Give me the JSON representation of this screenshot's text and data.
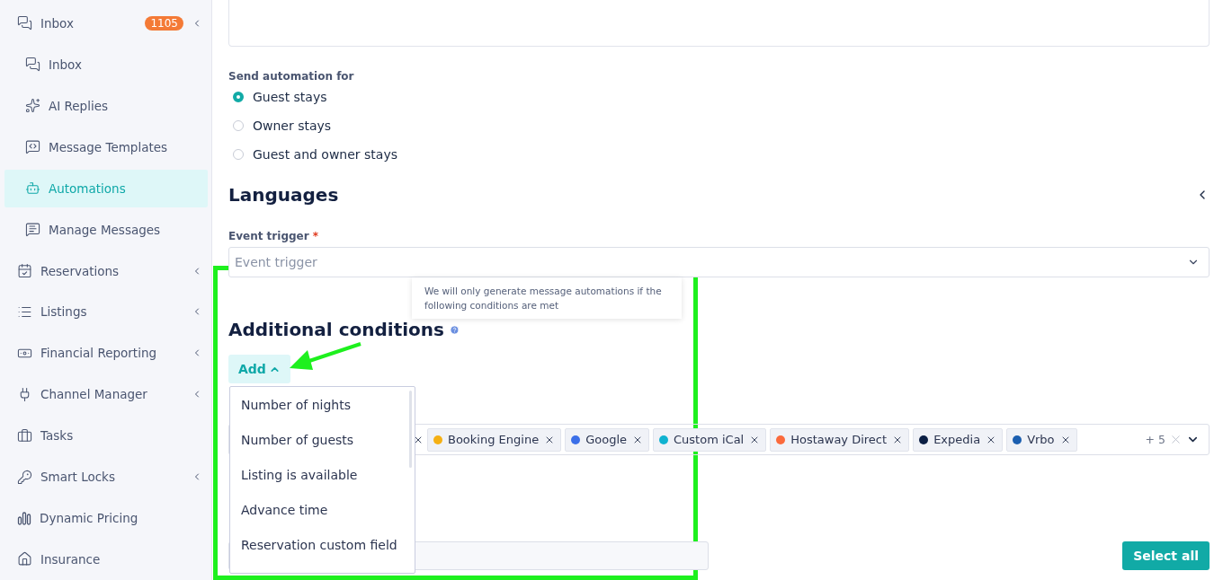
{
  "sidebar": {
    "items": [
      {
        "label": "Inbox",
        "badge": "1105",
        "expandable": true,
        "selected": false,
        "children": [
          {
            "label": "Inbox",
            "selected": false
          },
          {
            "label": "AI Replies",
            "selected": false
          },
          {
            "label": "Message Templates",
            "selected": false
          },
          {
            "label": "Automations",
            "selected": true
          },
          {
            "label": "Manage Messages",
            "selected": false
          }
        ]
      },
      {
        "label": "Reservations",
        "expandable": true,
        "selected": false
      },
      {
        "label": "Listings",
        "expandable": true,
        "selected": false
      },
      {
        "label": "Financial Reporting",
        "expandable": true,
        "selected": false
      },
      {
        "label": "Channel Manager",
        "expandable": true,
        "selected": false
      },
      {
        "label": "Tasks",
        "expandable": false,
        "selected": false
      },
      {
        "label": "Smart Locks",
        "expandable": true,
        "selected": false
      },
      {
        "label": "Dynamic Pricing",
        "expandable": false,
        "selected": false
      },
      {
        "label": "Insurance",
        "expandable": false,
        "selected": false
      }
    ]
  },
  "send_for": {
    "label": "Send automation for",
    "options": [
      {
        "label": "Guest stays",
        "selected": true
      },
      {
        "label": "Owner stays",
        "selected": false
      },
      {
        "label": "Guest and owner stays",
        "selected": false
      }
    ]
  },
  "languages": {
    "title": "Languages",
    "expanded": false
  },
  "event_trigger": {
    "label": "Event trigger",
    "required_mark": "*",
    "placeholder": "Event trigger"
  },
  "tooltip": "We will only generate message automations if the following conditions are met",
  "additional_conditions": {
    "title": "Additional conditions",
    "add_button": "Add",
    "menu_open": true,
    "menu": [
      "Number of nights",
      "Number of guests",
      "Listing is available",
      "Advance time",
      "Reservation custom field"
    ]
  },
  "channels": {
    "tags": [
      {
        "label": "Booking Engine",
        "color": "#f5b014"
      },
      {
        "label": "Google",
        "color": "#3b6fe8"
      },
      {
        "label": "Custom iCal",
        "color": "#10b2d0"
      },
      {
        "label": "Hostaway Direct",
        "color": "#fb6a3c"
      },
      {
        "label": "Expedia",
        "color": "#0c1f44"
      },
      {
        "label": "Vrbo",
        "color": "#1c5fb0"
      }
    ],
    "more": "+ 5"
  },
  "select_all": "Select all"
}
